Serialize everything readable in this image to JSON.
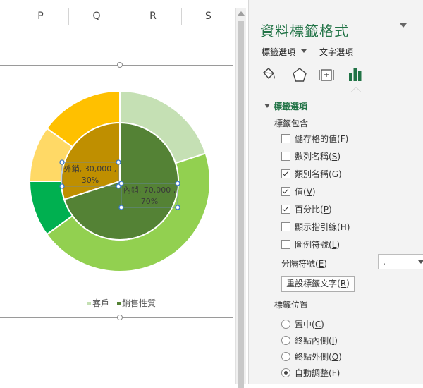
{
  "sheet": {
    "columns": [
      "P",
      "Q",
      "R",
      "S"
    ]
  },
  "chart_data": {
    "type": "doughnut",
    "legend_position": "bottom",
    "series": [
      {
        "name": "客戶",
        "ring": "outer",
        "values": [
          20,
          45,
          10,
          10,
          15
        ],
        "colors": [
          "#c5e0b4",
          "#92d050",
          "#00b050",
          "#ffd966",
          "#ffc000"
        ]
      },
      {
        "name": "銷售性質",
        "ring": "inner",
        "categories": [
          "內銷",
          "外銷"
        ],
        "values": [
          70000,
          30000
        ],
        "colors": [
          "#548235",
          "#bf8f00"
        ]
      }
    ],
    "data_labels": [
      {
        "line1": "外銷, 30,000 ,",
        "line2": "30%"
      },
      {
        "line1": "內銷, 70,000 ,",
        "line2": "70%"
      }
    ],
    "legend": [
      {
        "label": "客戶",
        "color": "#c5e0b4"
      },
      {
        "label": "銷售性質",
        "color": "#548235"
      }
    ]
  },
  "pane": {
    "title": "資料標籤格式",
    "tabs": [
      "標籤選項",
      "文字選項"
    ],
    "icons": [
      "fill-bucket-icon",
      "pentagon-effects-icon",
      "size-properties-icon",
      "bar-chart-options-icon"
    ],
    "section_title": "標籤選項",
    "contains_heading": "標籤包含",
    "options": [
      {
        "label": "儲存格的值",
        "key": "F",
        "checked": false
      },
      {
        "label": "數列名稱",
        "key": "S",
        "checked": false
      },
      {
        "label": "類別名稱",
        "key": "G",
        "checked": true
      },
      {
        "label": "值",
        "key": "V",
        "checked": true
      },
      {
        "label": "百分比",
        "key": "P",
        "checked": true
      },
      {
        "label": "顯示指引線",
        "key": "H",
        "checked": false
      },
      {
        "label": "圖例符號",
        "key": "L",
        "checked": false
      }
    ],
    "separator_label": "分隔符號",
    "separator_key": "E",
    "separator_value": ",",
    "reset_button": "重設標籤文字",
    "reset_key": "R",
    "position_heading": "標籤位置",
    "positions": [
      {
        "label": "置中",
        "key": "C",
        "checked": false
      },
      {
        "label": "終點內側",
        "key": "I",
        "checked": false
      },
      {
        "label": "終點外側",
        "key": "O",
        "checked": false
      },
      {
        "label": "自動調整",
        "key": "F",
        "checked": true
      }
    ],
    "accent_color": "#217346"
  }
}
